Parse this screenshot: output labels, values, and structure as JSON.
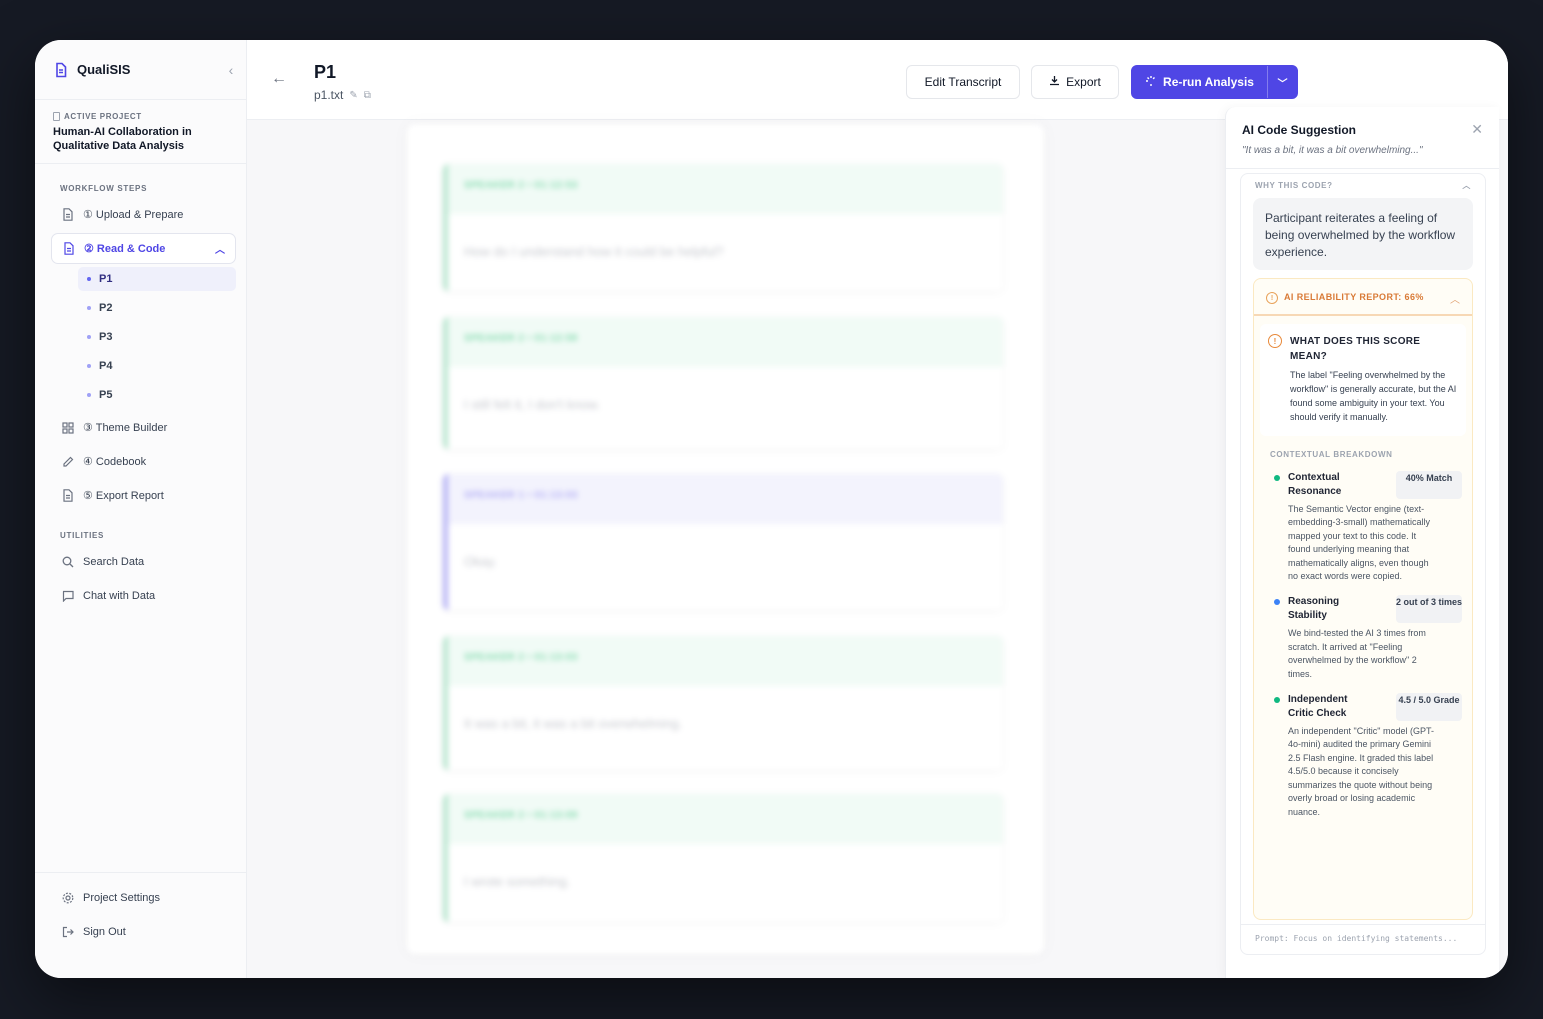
{
  "app": {
    "name": "QualiSIS"
  },
  "project": {
    "label": "ACTIVE PROJECT",
    "name": "Human-AI Collaboration in Qualitative Data Analysis"
  },
  "sidebar": {
    "workflow_title": "WORKFLOW STEPS",
    "steps": [
      {
        "label": "① Upload & Prepare"
      },
      {
        "label": "② Read & Code"
      },
      {
        "label": "③ Theme Builder"
      },
      {
        "label": "④ Codebook"
      },
      {
        "label": "⑤ Export Report"
      }
    ],
    "files": [
      "P1",
      "P2",
      "P3",
      "P4",
      "P5"
    ],
    "utilities_title": "UTILITIES",
    "utilities": [
      {
        "label": "Search Data"
      },
      {
        "label": "Chat with Data"
      }
    ],
    "footer": [
      {
        "label": "Project Settings"
      },
      {
        "label": "Sign Out"
      }
    ]
  },
  "header": {
    "title": "P1",
    "filename": "p1.txt",
    "edit_label": "Edit Transcript",
    "export_label": "Export",
    "rerun_label": "Re-run Analysis"
  },
  "transcript": [
    {
      "speaker": "SPEAKER 2 • 01:12:53",
      "text": "How do I understand how it could be helpful?"
    },
    {
      "speaker": "SPEAKER 2 • 01:12:58",
      "text": "I still felt it, I don't know."
    },
    {
      "speaker": "SPEAKER 1 • 01:13:03",
      "text": "Okay."
    },
    {
      "speaker": "SPEAKER 2 • 01:13:03",
      "text": "It was a bit, it was a bit overwhelming."
    },
    {
      "speaker": "SPEAKER 2 • 01:13:09",
      "text": "I wrote something."
    }
  ],
  "ai": {
    "title": "AI Code Suggestion",
    "quote": "\"It was a bit, it was a bit overwhelming...\"",
    "why_title": "WHY THIS CODE?",
    "why_text": "Participant reiterates a feeling of being overwhelmed by the workflow experience.",
    "reliability_title": "AI RELIABILITY REPORT: 66%",
    "meaning_title": "WHAT DOES THIS SCORE MEAN?",
    "meaning_text": "The label \"Feeling overwhelmed by the workflow\" is generally accurate, but the AI found some ambiguity in your text. You should verify it manually.",
    "breakdown_title": "CONTEXTUAL BREAKDOWN",
    "metrics": [
      {
        "name": "Contextual Resonance",
        "badge": "40% Match",
        "color": "#10b981",
        "desc": "The Semantic Vector engine (text-embedding-3-small) mathematically mapped your text to this code. It found underlying meaning that mathematically aligns, even though no exact words were copied."
      },
      {
        "name": "Reasoning Stability",
        "badge": "2 out of 3 times",
        "color": "#3b82f6",
        "desc": "We bind-tested the AI 3 times from scratch. It arrived at \"Feeling overwhelmed by the workflow\" 2 times."
      },
      {
        "name": "Independent Critic Check",
        "badge": "4.5 / 5.0 Grade",
        "color": "#10b981",
        "desc": "An independent \"Critic\" model (GPT-4o-mini) audited the primary Gemini 2.5 Flash engine. It graded this label 4.5/5.0 because it concisely summarizes the quote without being overly broad or losing academic nuance."
      }
    ],
    "prompt": "Prompt: Focus on identifying statements..."
  }
}
